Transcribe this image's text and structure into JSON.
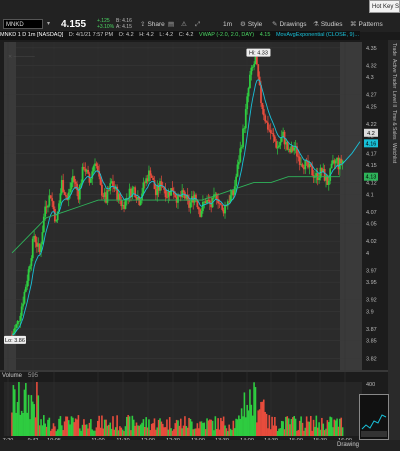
{
  "toolbar": {
    "symbol": "MNKD",
    "last_price": "4.155",
    "change": "+.125",
    "change_pct": "+3.10%",
    "bid": "B: 4.16",
    "ask": "A: 4.15",
    "share_label": "Share",
    "timeframe_label": "1m",
    "style_label": "Style",
    "drawings_label": "Drawings",
    "studies_label": "Studies",
    "patterns_label": "Patterns"
  },
  "hotkey_label": "Hot Key Set",
  "info_bar": {
    "title": "MNKD 1 D 1m [NASDAQ]",
    "date": "D: 4/1/21 7:57 PM",
    "open": "O: 4.2",
    "high": "H: 4.2",
    "low": "L: 4.2",
    "close": "C: 4.2",
    "vwap": "VWAP (-2.0, 2.0, DAY)",
    "vwap_value": "4.15",
    "movavg": "MovAvgExponential (CLOSE, 9)..."
  },
  "annotations": {
    "hi_label": "Hi: 4.33",
    "lo_label": "Lo: 3.86"
  },
  "price_badges": {
    "last": "4.2",
    "close": "4.16",
    "vwap": "4.13"
  },
  "volume_header": {
    "label": "Volume",
    "value": "595"
  },
  "volume_axis": {
    "top": "400"
  },
  "right_panel_tabs": [
    "Trade",
    "Active Trader",
    "Level II",
    "Time & Sales",
    "Watchlist"
  ],
  "bottom_bar": {
    "drawing_label": "Drawing"
  },
  "colors": {
    "up": "#2ecc40",
    "down": "#e74c3c",
    "ema": "#19c0d8",
    "vwap": "#2fb35a"
  },
  "chart_data": {
    "type": "candlestick",
    "y_ticks": [
      "4.35",
      "4.32",
      "4.3",
      "4.27",
      "4.25",
      "4.22",
      "4.2",
      "4.17",
      "4.15",
      "4.12",
      "4.1",
      "4.07",
      "4.05",
      "4.02",
      "4",
      "3.97",
      "3.95",
      "3.92",
      "3.9",
      "3.87",
      "3.85",
      "3.82"
    ],
    "ylim": [
      3.8,
      4.36
    ],
    "x_ticks": [
      "7:20",
      "9:42",
      "10:05",
      "11:00",
      "11:30",
      "12:00",
      "12:30",
      "13:00",
      "13:30",
      "14:00",
      "14:30",
      "15:00",
      "15:30",
      "16:00"
    ],
    "high": 4.33,
    "low": 3.86,
    "price_path": [
      3.86,
      3.88,
      3.92,
      3.97,
      4.03,
      4.0,
      4.08,
      4.1,
      4.05,
      4.12,
      4.09,
      4.13,
      4.1,
      4.15,
      4.12,
      4.16,
      4.11,
      4.09,
      4.12,
      4.1,
      4.08,
      4.1,
      4.11,
      4.09,
      4.12,
      4.14,
      4.1,
      4.12,
      4.1,
      4.11,
      4.09,
      4.1,
      4.08,
      4.1,
      4.07,
      4.09,
      4.08,
      4.1,
      4.07,
      4.09,
      4.1,
      4.16,
      4.22,
      4.3,
      4.33,
      4.26,
      4.22,
      4.2,
      4.18,
      4.2,
      4.17,
      4.18,
      4.16,
      4.15,
      4.14,
      4.13,
      4.14,
      4.12,
      4.15,
      4.16
    ],
    "vwap_path": [
      4.0,
      4.03,
      4.06,
      4.07,
      4.08,
      4.09,
      4.09,
      4.09,
      4.09,
      4.09,
      4.09,
      4.09,
      4.1,
      4.11,
      4.12,
      4.12,
      4.13,
      4.13,
      4.13,
      4.13
    ],
    "volume_ylim": [
      0,
      400
    ]
  }
}
